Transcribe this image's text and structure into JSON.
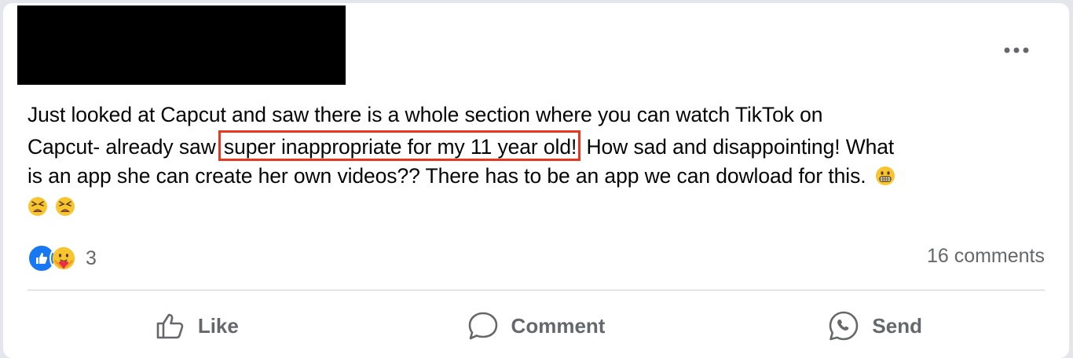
{
  "post": {
    "text_lines": [
      "Just looked at Capcut and saw there is a whole section where you can watch TikTok on",
      "Capcut- already saw ",
      "How sad and disappointing! What",
      "is an app she can create her own videos?? There has to be an app we can dowload for this."
    ],
    "highlighted_text": "super inappropriate for my 11 year old!",
    "trailing_emojis": [
      "grimacing-face",
      "tired-face",
      "tired-face"
    ]
  },
  "reactions": {
    "types": [
      "like",
      "care"
    ],
    "count": "3"
  },
  "comments": {
    "label": "16 comments"
  },
  "actions": {
    "like_label": "Like",
    "comment_label": "Comment",
    "send_label": "Send"
  },
  "colors": {
    "highlight_border": "#e8361f",
    "like_blue": "#1877f2",
    "muted_text": "#65676b"
  }
}
